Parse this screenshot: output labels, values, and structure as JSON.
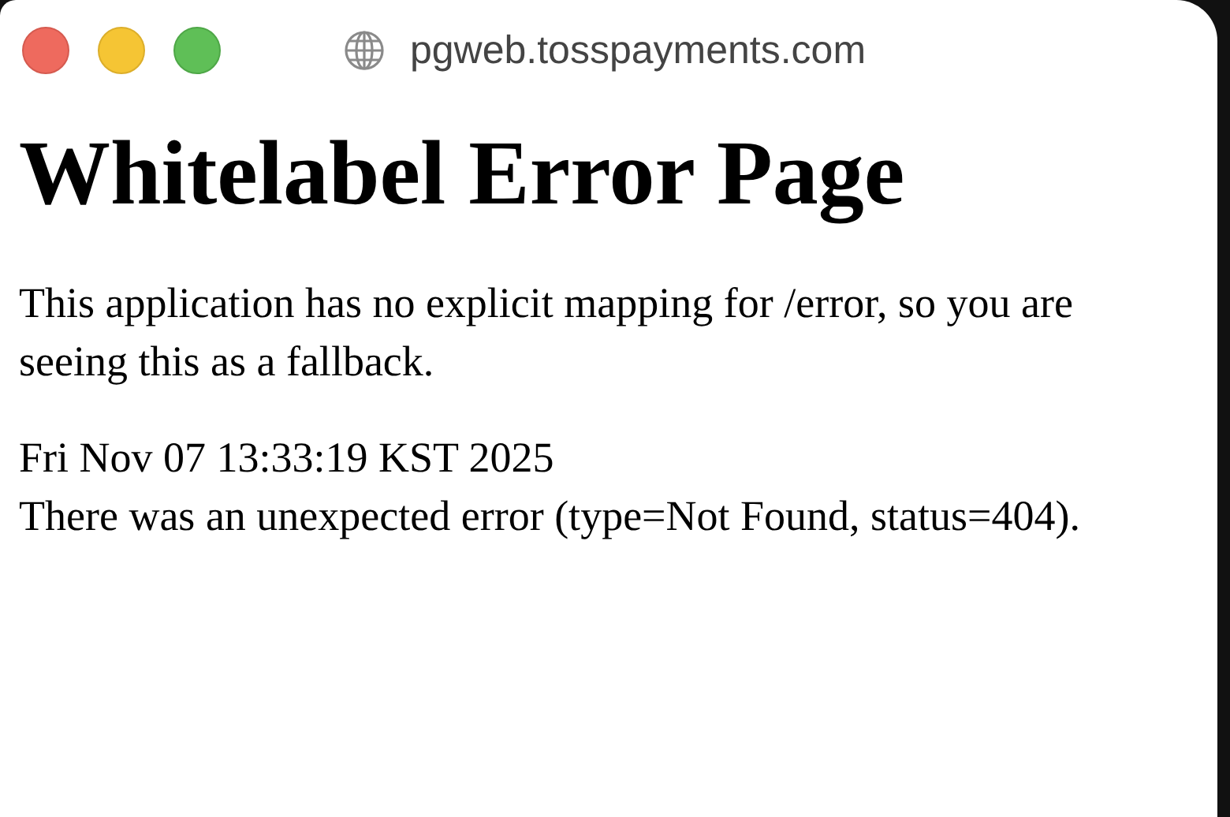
{
  "window": {
    "address": "pgweb.tosspayments.com"
  },
  "page": {
    "heading": "Whitelabel Error Page",
    "message": "This application has no explicit mapping for /error, so you are seeing this as a fallback.",
    "timestamp": "Fri Nov 07 13:33:19 KST 2025",
    "error": "There was an unexpected error (type=Not Found, status=404)."
  }
}
